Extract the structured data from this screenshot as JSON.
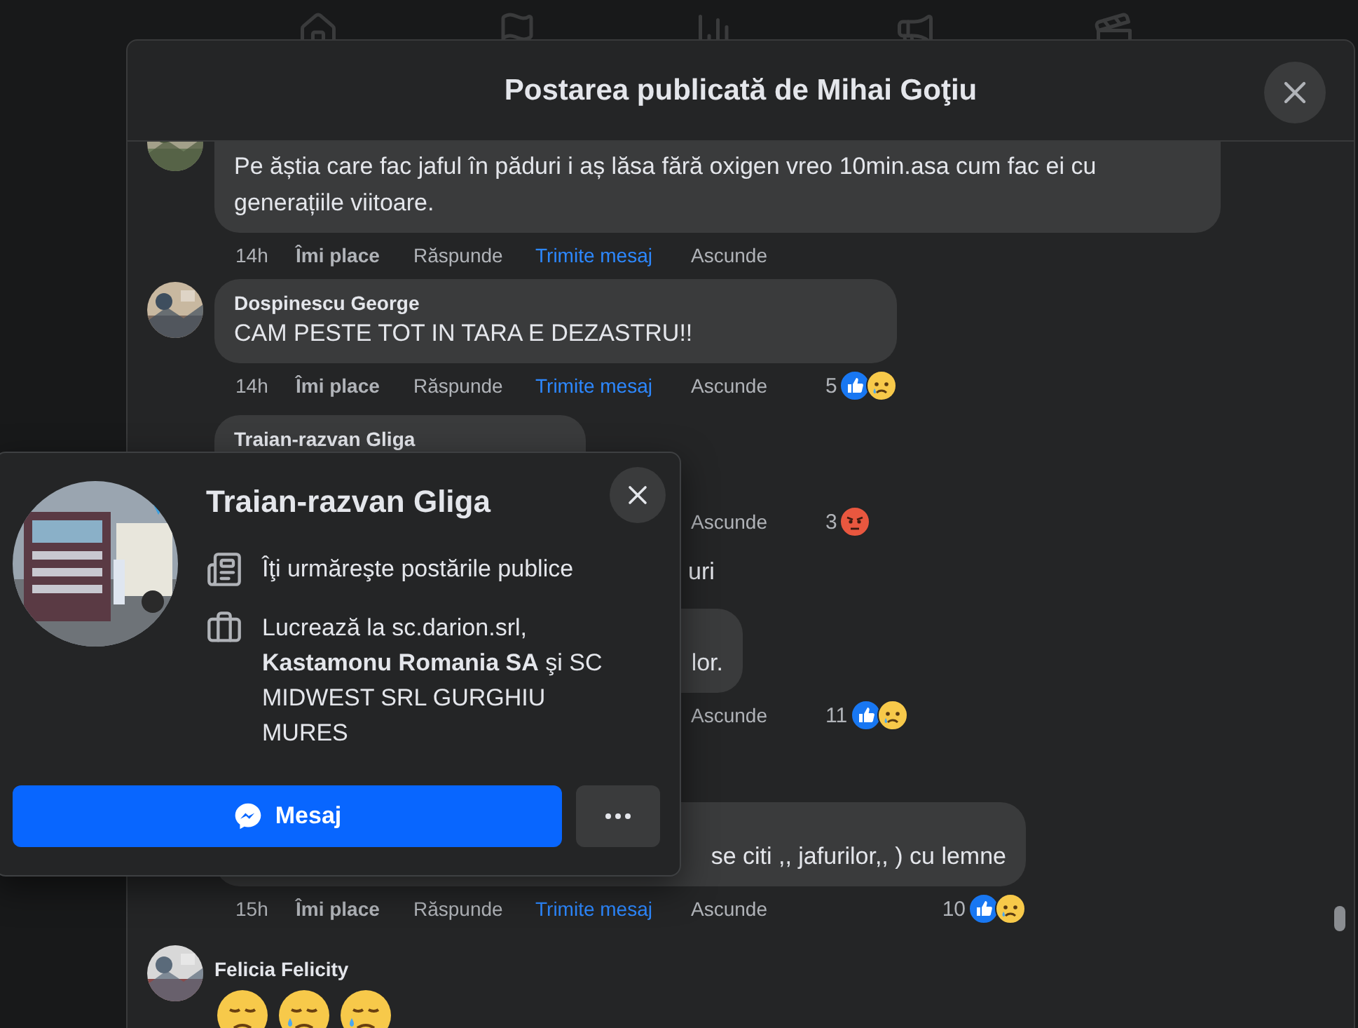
{
  "dialog": {
    "title": "Postarea publicată de Mihai Goţiu"
  },
  "comments": [
    {
      "kind": "comment",
      "avatar": true,
      "text": "Pe ăștia care fac jaful în păduri i aș lăsa fără oxigen vreo 10min.asa cum fac ei cu generațiile viitoare.",
      "actions": [
        {
          "kind": "time",
          "label": "14h"
        },
        {
          "kind": "like",
          "label": "Îmi place"
        },
        {
          "kind": "reply",
          "label": "Răspunde"
        },
        {
          "kind": "message",
          "label": "Trimite mesaj"
        },
        {
          "kind": "hide",
          "label": "Ascunde"
        }
      ]
    },
    {
      "kind": "comment",
      "avatar": true,
      "author": "Dospinescu George",
      "text": "CAM PESTE TOT IN TARA E DEZASTRU!!",
      "actions": [
        {
          "kind": "time",
          "label": "14h"
        },
        {
          "kind": "like",
          "label": "Îmi place"
        },
        {
          "kind": "reply",
          "label": "Răspunde"
        },
        {
          "kind": "message",
          "label": "Trimite mesaj"
        },
        {
          "kind": "hide",
          "label": "Ascunde"
        }
      ],
      "reactions": {
        "count": "5",
        "icons": [
          {
            "kind": "like"
          },
          {
            "kind": "sad"
          }
        ]
      }
    },
    {
      "kind": "comment",
      "avatar": false,
      "author": "Traian-razvan Gliga",
      "actions": [
        {
          "kind": "hide",
          "label": "Ascunde"
        }
      ],
      "reactions": {
        "count": "3",
        "icons": [
          {
            "kind": "angry"
          }
        ]
      }
    },
    {
      "kind": "fragment",
      "text": "uri"
    },
    {
      "kind": "comment",
      "avatar": false,
      "text": "lor.",
      "actions": [
        {
          "kind": "hide",
          "label": "Ascunde"
        }
      ],
      "reactions": {
        "count": "11",
        "icons": [
          {
            "kind": "like"
          },
          {
            "kind": "sad"
          }
        ]
      }
    },
    {
      "kind": "comment",
      "avatar": false,
      "text": "se citi ,, jafurilor,, ) cu lemne",
      "actions": [
        {
          "kind": "time",
          "label": "15h"
        },
        {
          "kind": "like",
          "label": "Îmi place"
        },
        {
          "kind": "reply",
          "label": "Răspunde"
        },
        {
          "kind": "message",
          "label": "Trimite mesaj"
        },
        {
          "kind": "hide",
          "label": "Ascunde"
        }
      ],
      "reactions": {
        "count": "10",
        "icons": [
          {
            "kind": "like"
          },
          {
            "kind": "sad"
          }
        ]
      }
    },
    {
      "kind": "emoji",
      "avatar": true,
      "author": "Felicia Felicity"
    }
  ],
  "profile_card": {
    "name": "Traian-razvan Gliga",
    "details": [
      {
        "kind": "follow",
        "text": "Îţi urmăreşte postările publice"
      },
      {
        "kind": "work",
        "text": "Lucrează la sc.darion.srl, **Kastamonu Romania SA** şi SC MIDWEST SRL GURGHIU MURES"
      }
    ],
    "buttons": [
      {
        "kind": "primary",
        "label": "Mesaj"
      },
      {
        "kind": "more"
      }
    ]
  }
}
